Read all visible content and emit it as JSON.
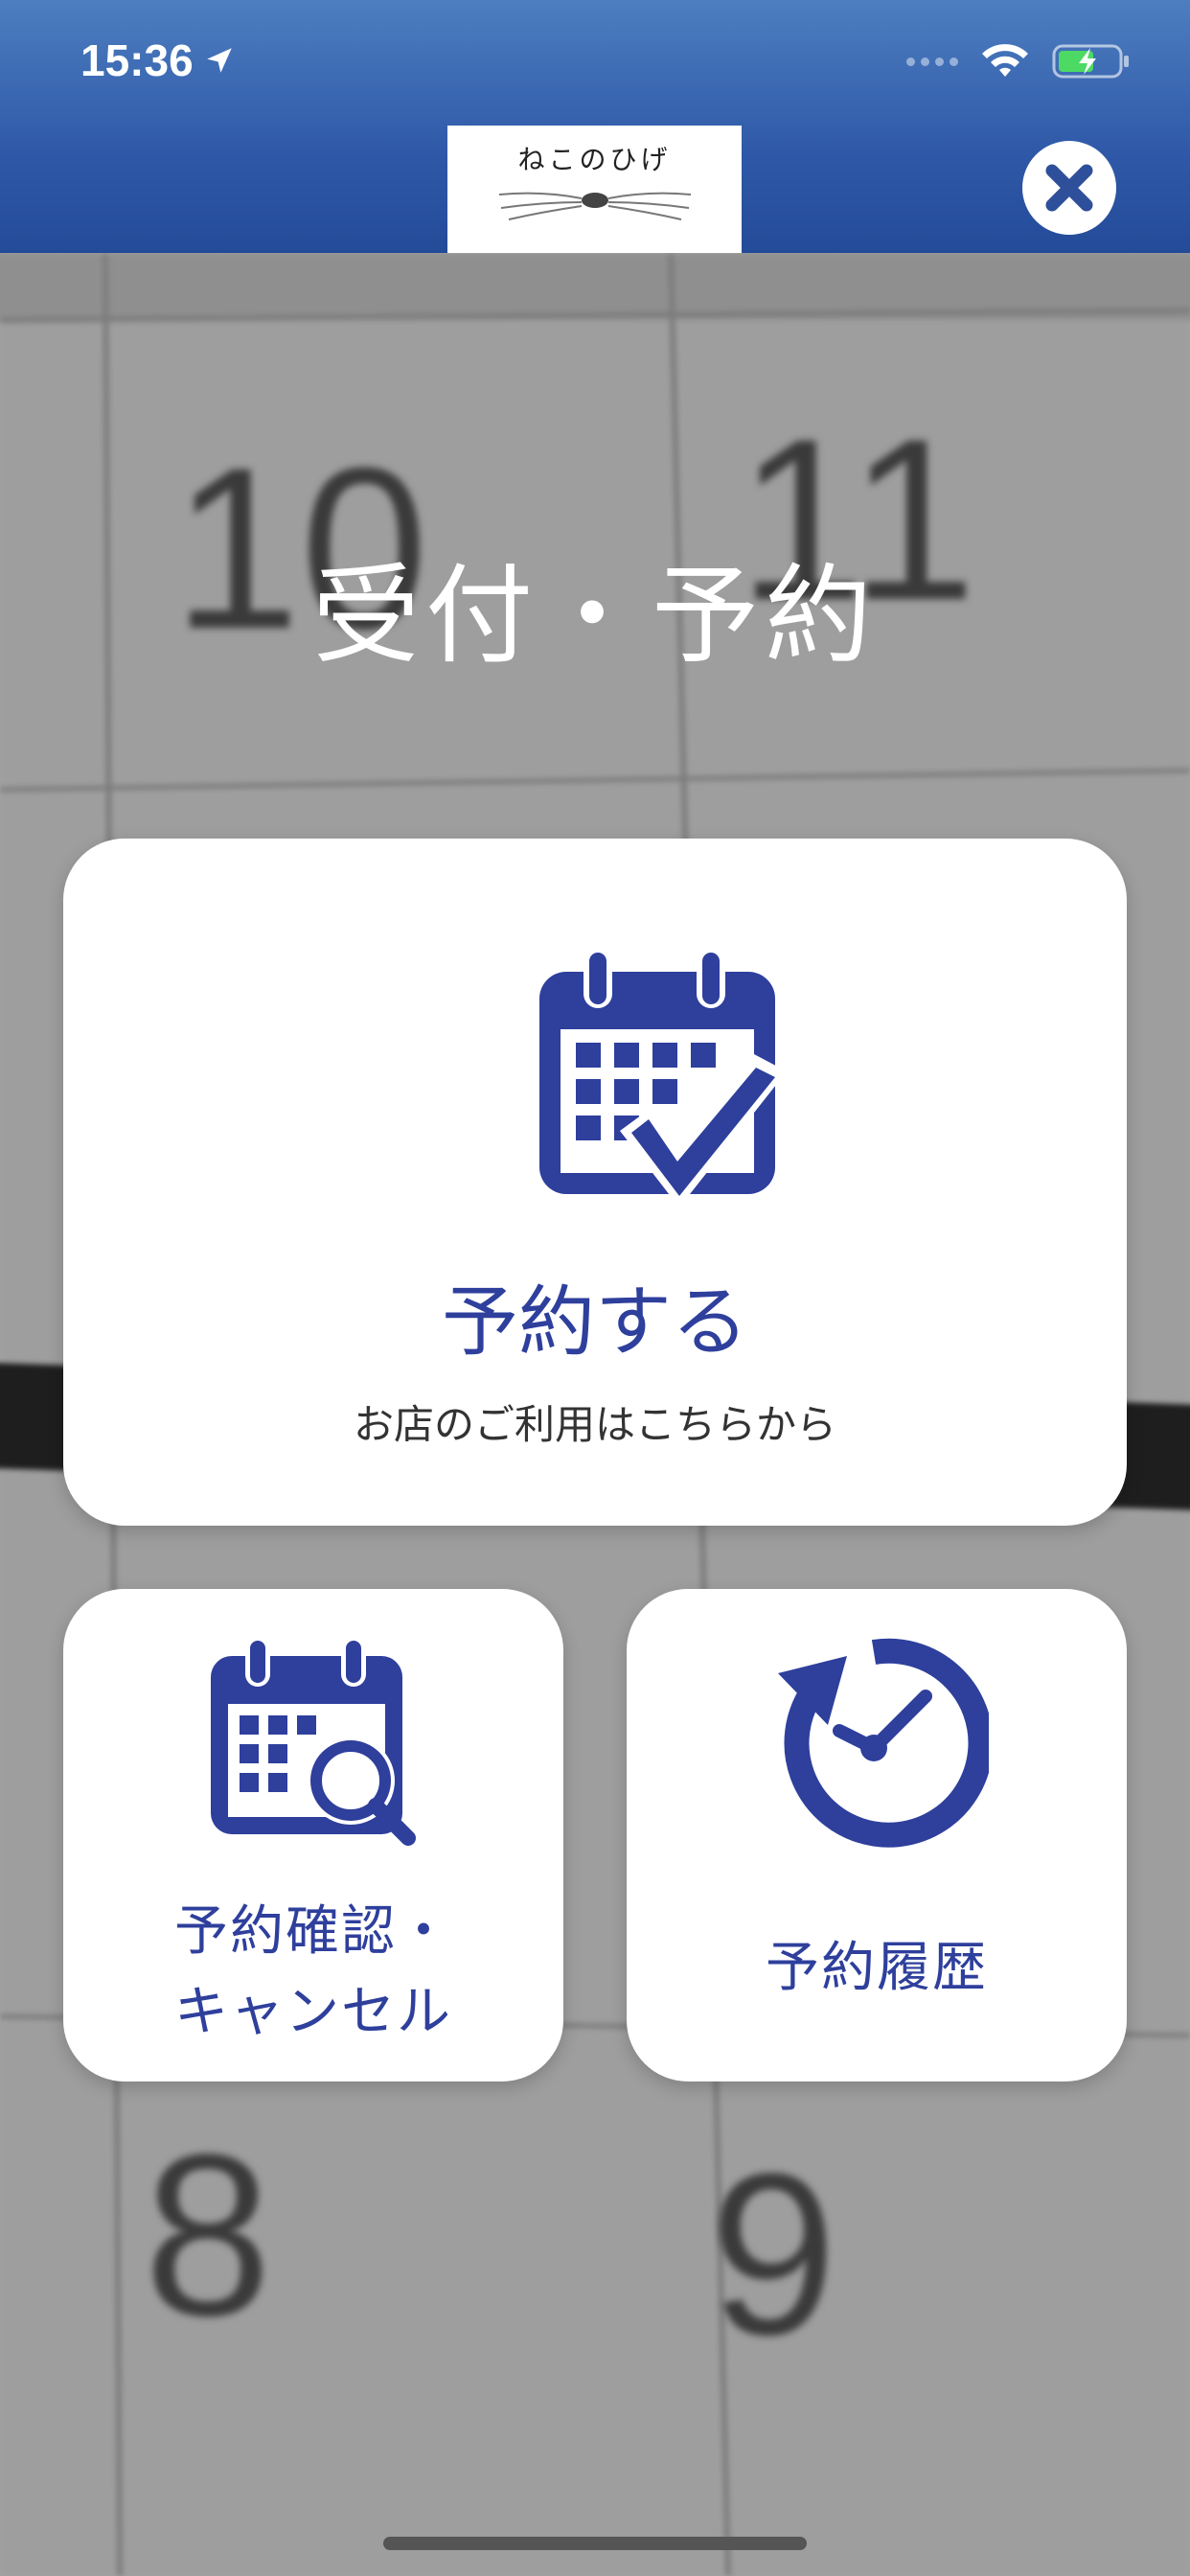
{
  "status_bar": {
    "time": "15:36"
  },
  "header": {
    "logo_text": "ねこのひげ"
  },
  "background": {
    "calendar_numbers": [
      "10",
      "11",
      "8",
      "9"
    ]
  },
  "page": {
    "title": "受付・予約"
  },
  "cards": {
    "reserve": {
      "label": "予約する",
      "sublabel": "お店のご利用はこちらから",
      "icon": "calendar-check-icon"
    },
    "confirm": {
      "label_line1": "予約確認・",
      "label_line2": "キャンセル",
      "icon": "calendar-search-icon"
    },
    "history": {
      "label": "予約履歴",
      "icon": "history-clock-icon"
    }
  },
  "colors": {
    "accent": "#2e3f9c",
    "header_top": "#4d7ec0",
    "header_bottom": "#234b98"
  }
}
